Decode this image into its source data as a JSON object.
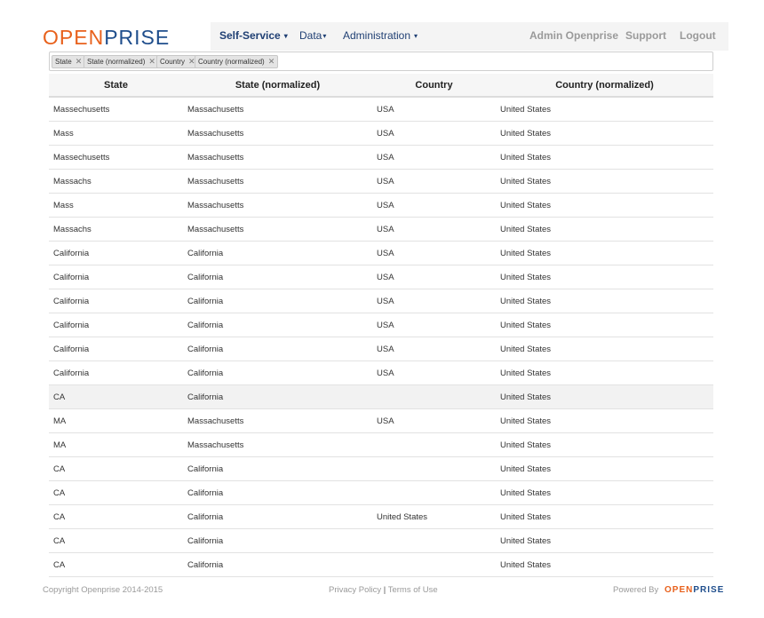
{
  "header": {
    "logo_part1": "OPEN",
    "logo_part2": "PRISE",
    "nav": [
      {
        "label": "Self-Service",
        "caret": "▾"
      },
      {
        "label": "Data",
        "caret": "▾"
      },
      {
        "label": "Administration",
        "caret": "▾"
      }
    ],
    "right_nav": [
      "Admin Openprise",
      "Support",
      "Logout"
    ]
  },
  "filters": [
    {
      "label": "State",
      "remove": "✕"
    },
    {
      "label": "State (normalized)",
      "remove": "✕"
    },
    {
      "label": "Country",
      "remove": "✕"
    },
    {
      "label": "Country (normalized)",
      "remove": "✕"
    }
  ],
  "table": {
    "columns": [
      "State",
      "State (normalized)",
      "Country",
      "Country (normalized)"
    ],
    "rows": [
      [
        "Massechusetts",
        "Massachusetts",
        "USA",
        "United States"
      ],
      [
        "Mass",
        "Massachusetts",
        "USA",
        "United States"
      ],
      [
        "Massechusetts",
        "Massachusetts",
        "USA",
        "United States"
      ],
      [
        "Massachs",
        "Massachusetts",
        "USA",
        "United States"
      ],
      [
        "Mass",
        "Massachusetts",
        "USA",
        "United States"
      ],
      [
        "Massachs",
        "Massachusetts",
        "USA",
        "United States"
      ],
      [
        "California",
        "California",
        "USA",
        "United States"
      ],
      [
        "California",
        "California",
        "USA",
        "United States"
      ],
      [
        "California",
        "California",
        "USA",
        "United States"
      ],
      [
        "California",
        "California",
        "USA",
        "United States"
      ],
      [
        "California",
        "California",
        "USA",
        "United States"
      ],
      [
        "California",
        "California",
        "USA",
        "United States"
      ],
      [
        "CA",
        "California",
        "",
        "United States"
      ],
      [
        "MA",
        "Massachusetts",
        "USA",
        "United States"
      ],
      [
        "MA",
        "Massachusetts",
        "",
        "United States"
      ],
      [
        "CA",
        "California",
        "",
        "United States"
      ],
      [
        "CA",
        "California",
        "",
        "United States"
      ],
      [
        "CA",
        "California",
        "United States",
        "United States"
      ],
      [
        "CA",
        "California",
        "",
        "United States"
      ],
      [
        "CA",
        "California",
        "",
        "United States"
      ]
    ],
    "highlighted_row": 12
  },
  "footer": {
    "copyright": "Copyright Openprise 2014-2015",
    "privacy": "Privacy Policy",
    "separator": "|",
    "terms": "Terms of Use",
    "powered_by": "Powered By",
    "logo_part1": "OPEN",
    "logo_part2": "PRISE"
  }
}
